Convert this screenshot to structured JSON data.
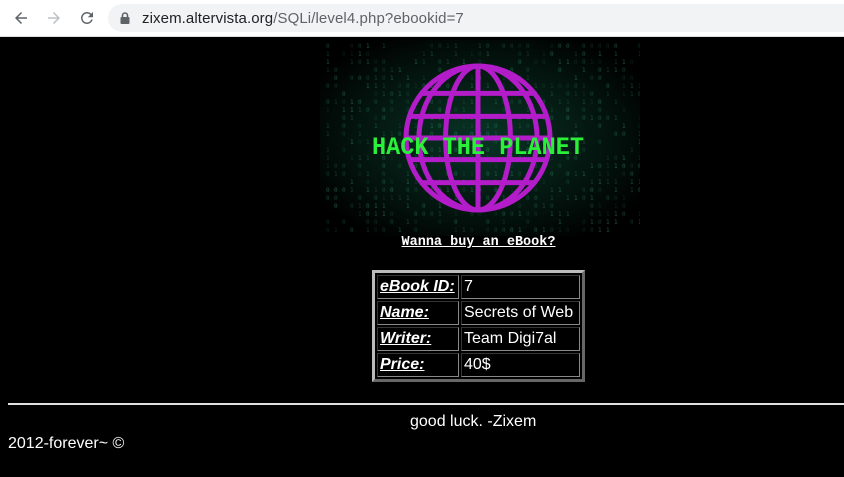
{
  "browser": {
    "url_host": "zixem.altervista.org",
    "url_path": "/SQLi/level4.php?ebookid=7"
  },
  "banner": {
    "text": "HACK THE PLANET",
    "globe_color": "#b21cc9",
    "text_color": "#2bf03a"
  },
  "main": {
    "link_label": "Wanna buy an eBook?",
    "table": [
      {
        "label": "eBook ID:",
        "value": "7"
      },
      {
        "label": "Name:",
        "value": "Secrets of Web"
      },
      {
        "label": "Writer:",
        "value": "Team Digi7al"
      },
      {
        "label": "Price:",
        "value": "40$"
      }
    ]
  },
  "footer": {
    "note": "good luck. -Zixem",
    "copyright": "2012-forever~ ©"
  }
}
